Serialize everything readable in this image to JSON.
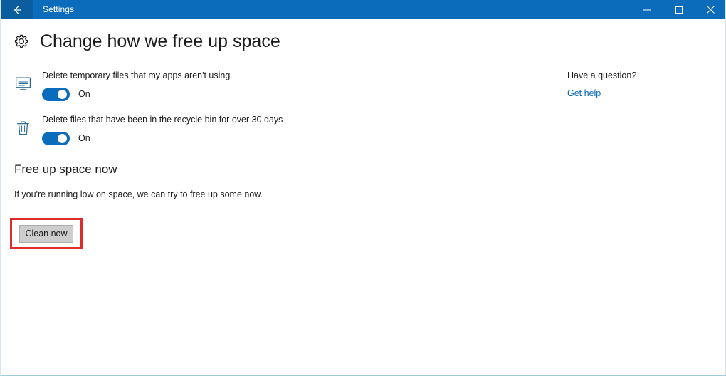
{
  "window": {
    "titlebar": {
      "back_icon": "arrow-left-icon",
      "title": "Settings",
      "accent_color": "#0a6cba",
      "back_button_color": "#0b5e9e",
      "controls": [
        {
          "name": "minimize",
          "glyph": "minimize-icon"
        },
        {
          "name": "maximize",
          "glyph": "maximize-icon"
        },
        {
          "name": "close",
          "glyph": "close-icon"
        }
      ]
    }
  },
  "page": {
    "icon": "gear-icon",
    "title": "Change how we free up space"
  },
  "settings": [
    {
      "icon": "monitor-icon",
      "label": "Delete temporary files that my apps aren't using",
      "toggle_state": "On",
      "toggle_on": true
    },
    {
      "icon": "recycle-bin-icon",
      "label": "Delete files that have been in the recycle bin for over 30 days",
      "toggle_state": "On",
      "toggle_on": true
    }
  ],
  "free_up_space": {
    "heading": "Free up space now",
    "description": "If you're running low on space, we can try to free up some now.",
    "button_label": "Clean now",
    "highlight_color": "#e02b2b"
  },
  "help": {
    "heading": "Have a question?",
    "link_label": "Get help",
    "link_color": "#0067b8"
  }
}
